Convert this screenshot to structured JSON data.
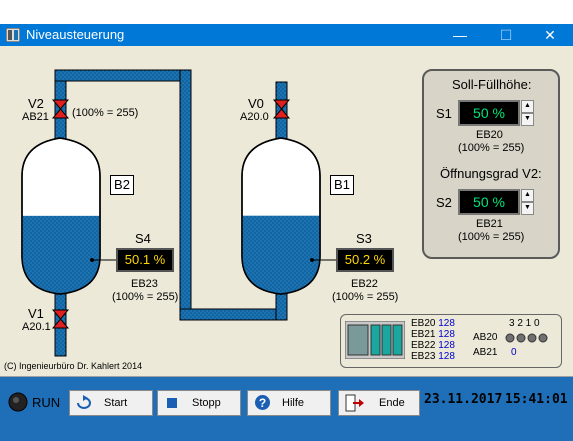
{
  "window": {
    "title": "Niveausteuerung",
    "controls": {
      "minimize": "—",
      "maximize": "☐",
      "close": "✕"
    }
  },
  "tanks": {
    "left": {
      "tag": "B2",
      "sensor": "S4",
      "level_pct": 50.1,
      "display": "50.1 %",
      "input_word": "EB23",
      "scale_note": "(100% = 255)"
    },
    "right": {
      "tag": "B1",
      "sensor": "S3",
      "level_pct": 50.2,
      "display": "50.2 %",
      "input_word": "EB22",
      "scale_note": "(100% = 255)"
    }
  },
  "valves": {
    "v2": {
      "name": "V2",
      "address": "AB21",
      "note": "(100% = 255)"
    },
    "v0": {
      "name": "V0",
      "address": "A20.0"
    },
    "v1": {
      "name": "V1",
      "address": "A20.1"
    }
  },
  "setpoints": {
    "fill_title": "Soll-Füllhöhe:",
    "s1": {
      "label": "S1",
      "value": "50 %",
      "word": "EB20",
      "note": "(100% = 255)"
    },
    "open_title": "Öffnungsgrad V2:",
    "s2": {
      "label": "S2",
      "value": "50 %",
      "word": "EB21",
      "note": "(100% = 255)"
    }
  },
  "plc": {
    "inputs": [
      {
        "name": "EB20",
        "value": "128"
      },
      {
        "name": "EB21",
        "value": "128"
      },
      {
        "name": "EB22",
        "value": "128"
      },
      {
        "name": "EB23",
        "value": "128"
      }
    ],
    "bit_header": "3 2 1 0",
    "ab20_label": "AB20",
    "ab21_label": "AB21",
    "ab21_value": "0"
  },
  "copyright": "(C) Ingenieurbüro Dr. Kahlert 2014",
  "bottom": {
    "run_label": "RUN",
    "start": "Start",
    "stop": "Stopp",
    "help": "Hilfe",
    "end": "Ende",
    "date": "23.11.2017",
    "time": "15:41:01"
  },
  "colors": {
    "water": "#1a73b5",
    "valve": "#e02020",
    "titlebar": "#0078d7",
    "bottom": "#1f6fb8"
  }
}
